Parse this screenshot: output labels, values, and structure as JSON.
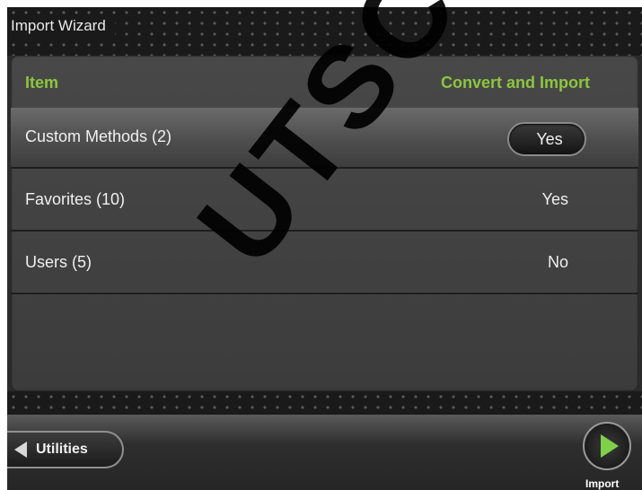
{
  "window": {
    "title": "Import Wizard"
  },
  "table": {
    "headers": {
      "item": "Item",
      "convert": "Convert and Import"
    },
    "rows": [
      {
        "label": "Custom Methods (2)",
        "value": "Yes",
        "selected": true
      },
      {
        "label": "Favorites (10)",
        "value": "Yes",
        "selected": false
      },
      {
        "label": "Users (5)",
        "value": "No",
        "selected": false
      }
    ]
  },
  "footer": {
    "back_label": "Utilities",
    "back_icon": "left-triangle-icon",
    "import_label": "Import",
    "import_icon": "play-icon"
  },
  "watermark": "UTSCHE",
  "colors": {
    "accent": "#8cc63f",
    "import_icon": "#7fd14a"
  }
}
